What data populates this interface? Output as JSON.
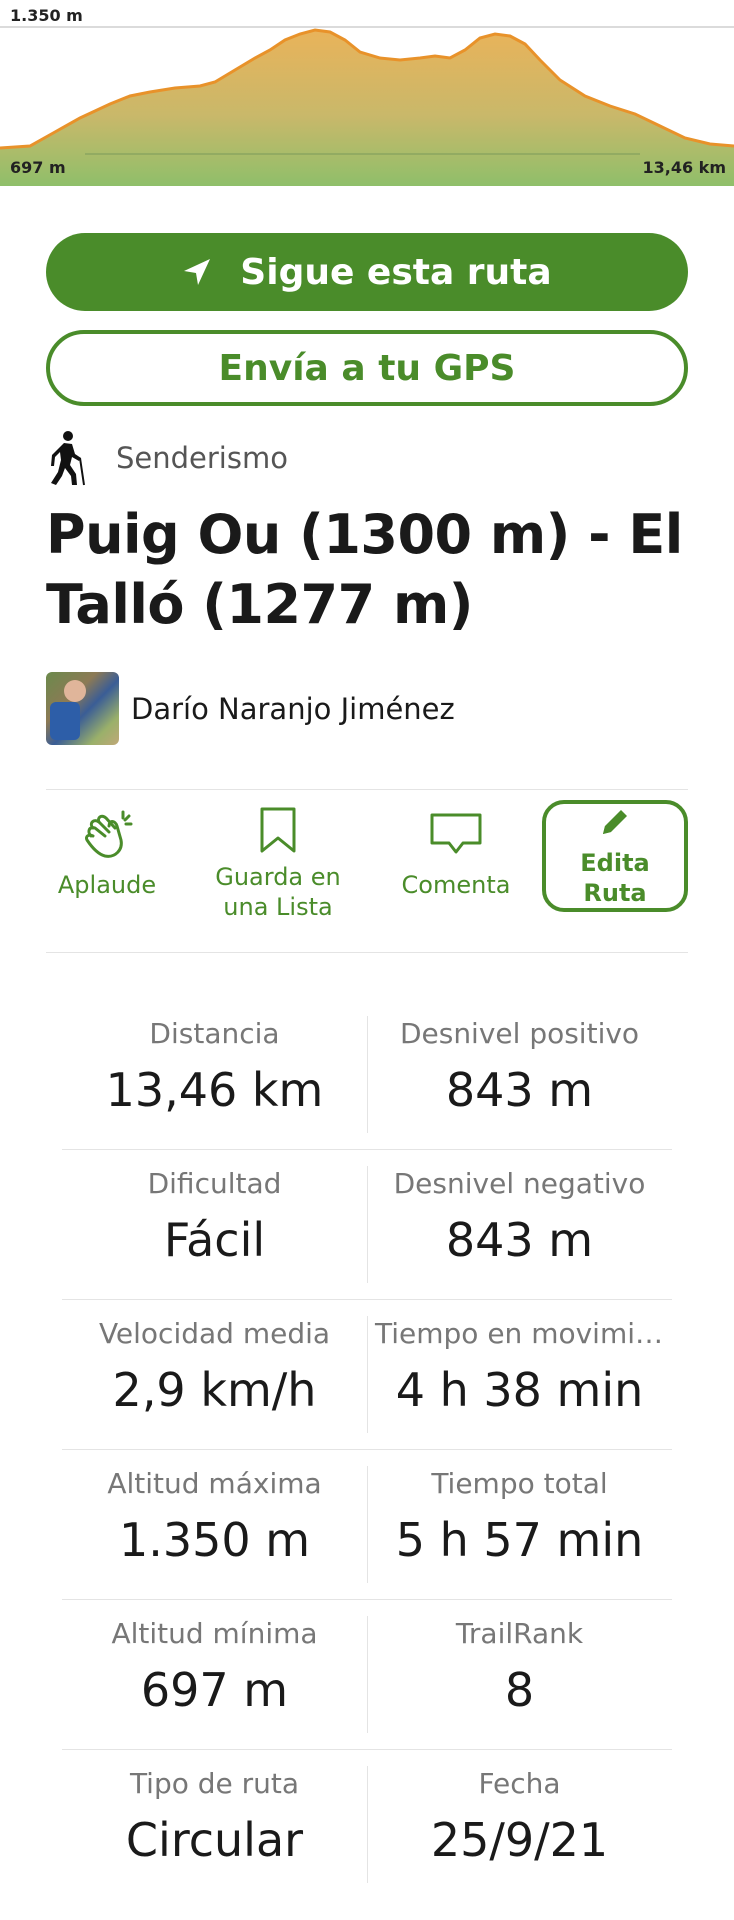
{
  "elevation_profile": {
    "max_label": "1.350 m",
    "min_label": "697 m",
    "distance_label": "13,46 km",
    "colors": {
      "line": "#e8922a",
      "fill_top": "#e9b35a",
      "fill_bottom": "#8fbf6a",
      "baseline": "#8fbd6c"
    }
  },
  "actions_top": {
    "follow_route": "Sigue esta ruta",
    "send_gps": "Envía a tu GPS"
  },
  "activity": {
    "label": "Senderismo",
    "icon": "hiker-icon"
  },
  "route": {
    "title": "Puig Ou (1300 m) - El Talló (1277 m)"
  },
  "author": {
    "name": "Darío Naranjo Jiménez"
  },
  "actions": {
    "applaud": "Aplaude",
    "save_line1": "Guarda en",
    "save_line2": "una Lista",
    "comment": "Comenta",
    "edit": "Edita Ruta"
  },
  "stats": [
    {
      "left": {
        "label": "Distancia",
        "value": "13,46 km"
      },
      "right": {
        "label": "Desnivel positivo",
        "value": "843 m"
      }
    },
    {
      "left": {
        "label": "Dificultad",
        "value": "Fácil"
      },
      "right": {
        "label": "Desnivel negativo",
        "value": "843 m"
      }
    },
    {
      "left": {
        "label": "Velocidad media",
        "value": "2,9 km/h"
      },
      "right": {
        "label": "Tiempo en movimie...",
        "value": "4 h 38 min"
      }
    },
    {
      "left": {
        "label": "Altitud máxima",
        "value": "1.350 m"
      },
      "right": {
        "label": "Tiempo total",
        "value": "5 h 57 min"
      }
    },
    {
      "left": {
        "label": "Altitud mínima",
        "value": "697 m"
      },
      "right": {
        "label": "TrailRank",
        "value": "8"
      }
    },
    {
      "left": {
        "label": "Tipo de ruta",
        "value": "Circular"
      },
      "right": {
        "label": "Fecha",
        "value": "25/9/21"
      }
    }
  ],
  "accent_color": "#4a8c2a"
}
